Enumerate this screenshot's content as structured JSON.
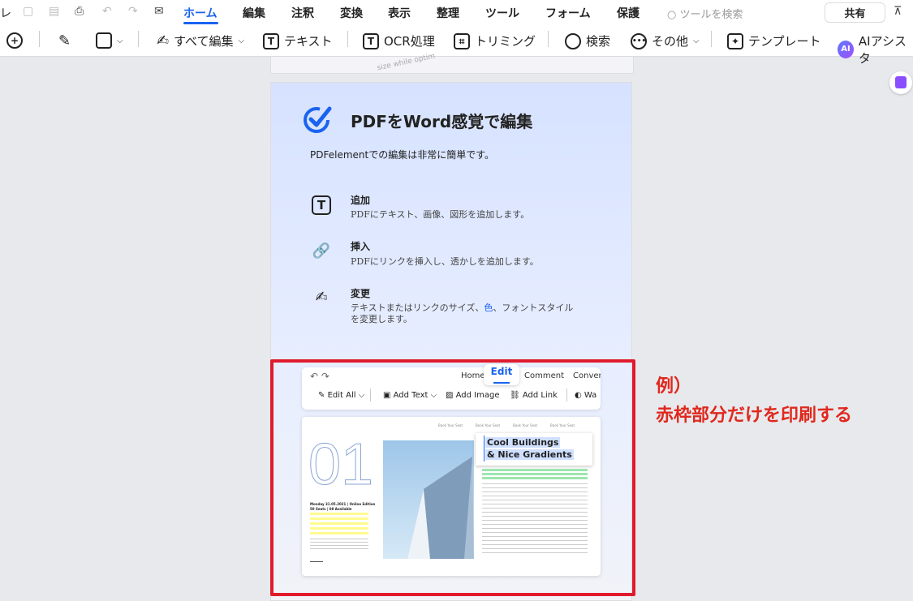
{
  "menu": {
    "edge_glyph": "レ",
    "tabs": [
      "ホーム",
      "編集",
      "注釈",
      "変換",
      "表示",
      "整理",
      "ツール",
      "フォーム",
      "保護"
    ],
    "search_placeholder": "ツールを検索",
    "share_label": "共有"
  },
  "toolbar": {
    "edit_all": "すべて編集",
    "text": "テキスト",
    "ocr": "OCR処理",
    "trim": "トリミング",
    "search": "検索",
    "other": "その他",
    "template": "テンプレート",
    "ai": "AIアシスタ",
    "ai_badge": "AI"
  },
  "page": {
    "title": "PDFをWord感覚で編集",
    "subtitle": "PDFelementでの編集は非常に簡単です。",
    "features": [
      {
        "title": "追加",
        "desc": "PDFにテキスト、画像、図形を追加します。"
      },
      {
        "title": "挿入",
        "desc": "PDFにリンクを挿入し、透かしを追加します。"
      },
      {
        "title": "変更",
        "desc_pre": "テキストまたはリンクのサイズ、",
        "desc_link": "色",
        "desc_post": "、フォントスタイル",
        "desc_line2": "を変更します。"
      }
    ],
    "strip_text": "size while optim"
  },
  "mock": {
    "tabs": [
      "Home",
      "Edit",
      "Comment",
      "Convert"
    ],
    "tools": [
      "Edit All",
      "Add Text",
      "Add Image",
      "Add Link",
      "Wa"
    ],
    "heading1": "Cool Buildings",
    "heading2": "& Nice Gradients",
    "big_number": "01",
    "nav_label": "Book Your Seat",
    "date_line": "Monday 31.05.2021 | Online Edition",
    "seats_line": "50 Seats | 08 Available"
  },
  "annotation": {
    "line1": "例）",
    "line2": "赤枠部分だけを印刷する"
  },
  "colors": {
    "accent": "#1a63f0",
    "annotation_red": "#e01b2d"
  }
}
